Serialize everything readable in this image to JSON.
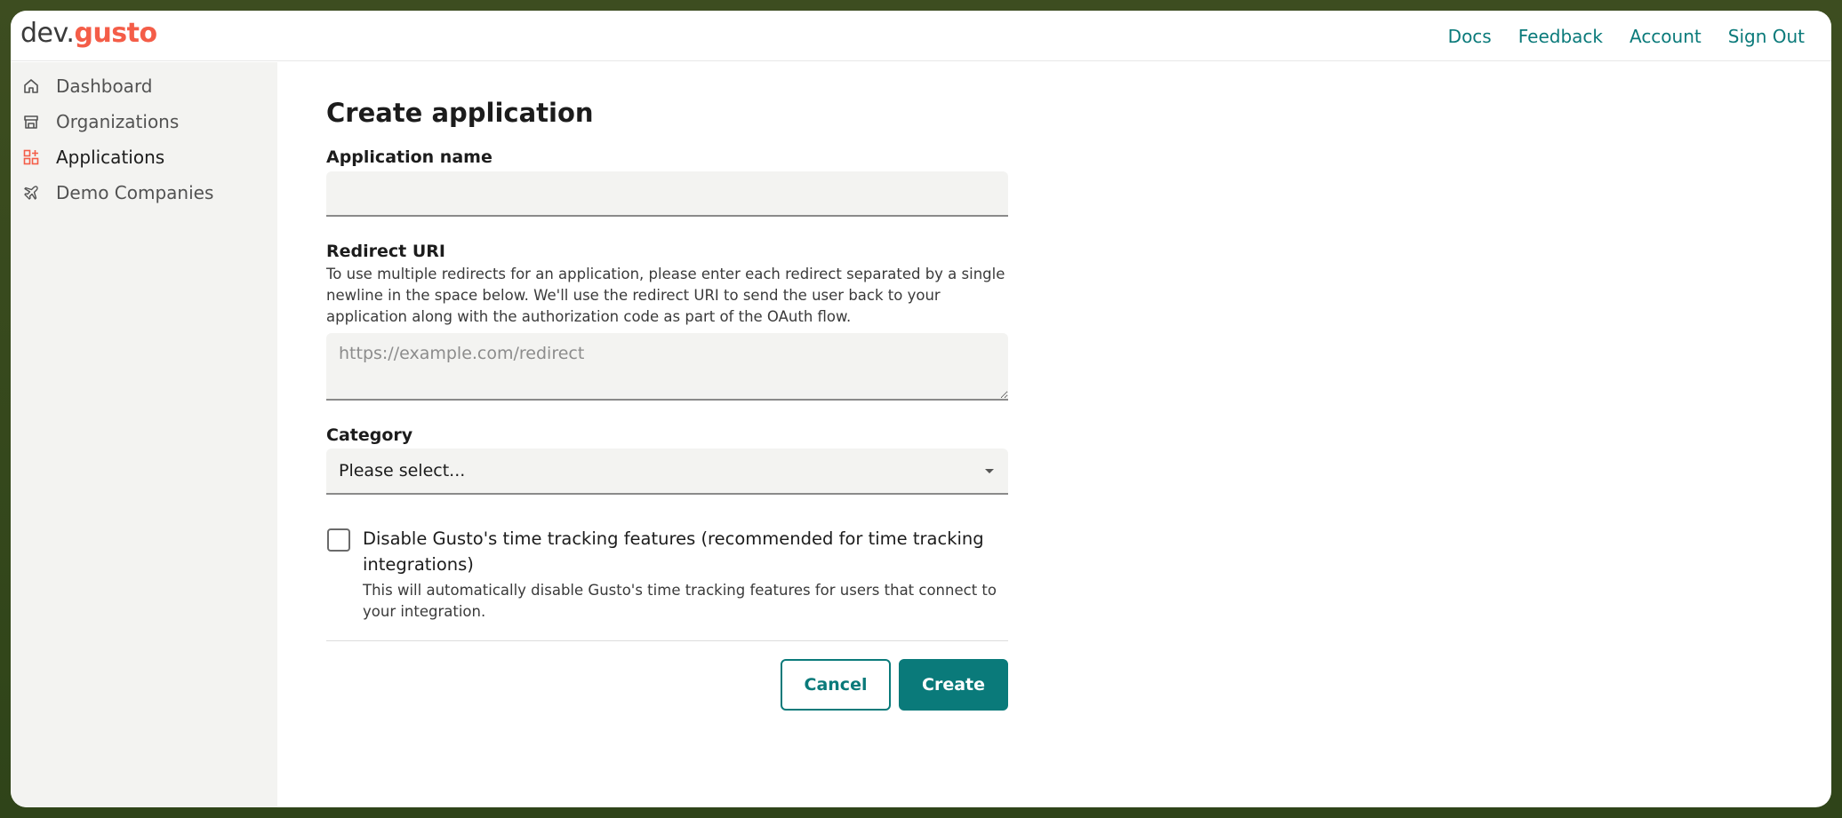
{
  "header": {
    "logo_prefix": "dev.",
    "logo_brand": "gusto",
    "nav": [
      "Docs",
      "Feedback",
      "Account",
      "Sign Out"
    ]
  },
  "sidebar": {
    "items": [
      {
        "label": "Dashboard",
        "icon": "home-icon"
      },
      {
        "label": "Organizations",
        "icon": "storefront-icon"
      },
      {
        "label": "Applications",
        "icon": "apps-grid-icon",
        "active": true
      },
      {
        "label": "Demo Companies",
        "icon": "airplane-icon"
      }
    ]
  },
  "form": {
    "title": "Create application",
    "app_name_label": "Application name",
    "app_name_value": "",
    "redirect_label": "Redirect URI",
    "redirect_help": "To use multiple redirects for an application, please enter each redirect separated by a single newline in the space below. We'll use the redirect URI to send the user back to your application along with the authorization code as part of the OAuth flow.",
    "redirect_placeholder": "https://example.com/redirect",
    "category_label": "Category",
    "category_selected": "Please select...",
    "checkbox_label": "Disable Gusto's time tracking features (recommended for time tracking integrations)",
    "checkbox_checked": false,
    "checkbox_help": "This will automatically disable Gusto's time tracking features for users that connect to your integration.",
    "cancel_label": "Cancel",
    "create_label": "Create"
  },
  "colors": {
    "accent": "#0a7a7a",
    "brand": "#f45d48",
    "sidebar_bg": "#f3f3f1"
  }
}
